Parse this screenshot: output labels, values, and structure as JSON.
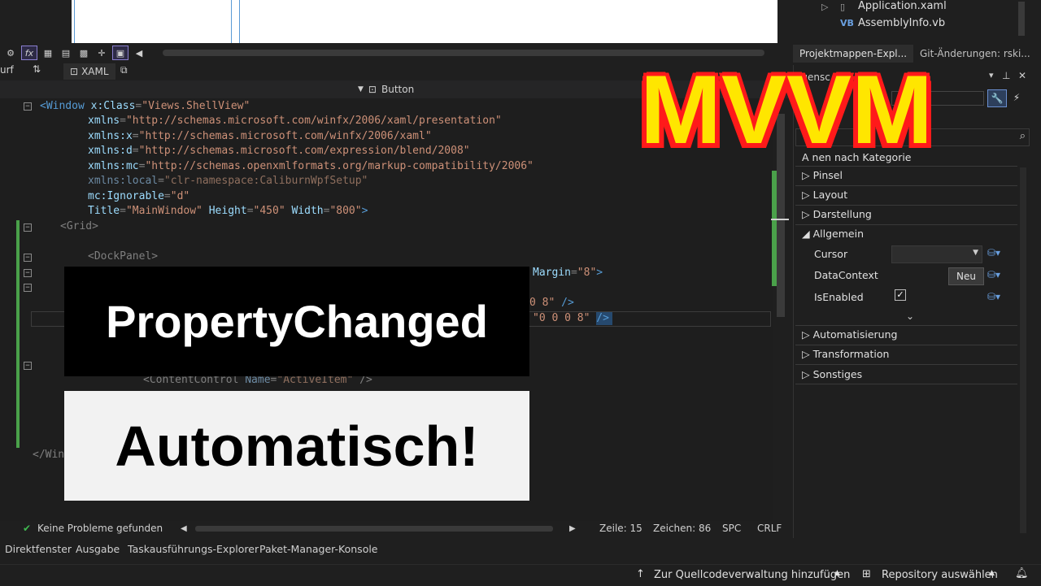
{
  "overlay": {
    "mvvm": "MVVM",
    "property_changed": "PropertyChanged",
    "automatisch": "Automatisch!"
  },
  "solution_explorer": {
    "items": [
      {
        "label": "Application.xaml"
      },
      {
        "label": "AssemblyInfo.vb",
        "badge": "VB"
      }
    ],
    "tab_solution": "Projektmappen-Expl...",
    "tab_git": "Git-Änderungen: rski..."
  },
  "editor": {
    "tab_left_partial": "urf",
    "tab_label": "XAML",
    "nav_element": "Button",
    "lines": {
      "l1_tag": "<Window",
      "l1_attr": "x:Class",
      "l1_val": "\"Views.ShellView\"",
      "l2_attr": "xmlns",
      "l2_val": "\"http://schemas.microsoft.com/winfx/2006/xaml/presentation\"",
      "l3_attr": "xmlns:x",
      "l3_val": "\"http://schemas.microsoft.com/winfx/2006/xaml\"",
      "l4_attr": "xmlns:d",
      "l4_val": "\"http://schemas.microsoft.com/expression/blend/2008\"",
      "l5_attr": "xmlns:mc",
      "l5_val": "\"http://schemas.openxmlformats.org/markup-compatibility/2006\"",
      "l6_attr": "xmlns:local",
      "l6_val": "\"clr-namespace:CaliburnWpfSetup\"",
      "l7_attr": "mc:Ignorable",
      "l7_val": "\"d\"",
      "l8_a1": "Title",
      "l8_v1": "\"MainWindow\"",
      "l8_a2": "Height",
      "l8_v2": "\"450\"",
      "l8_a3": "Width",
      "l8_v3": "\"800\"",
      "l9": "<Grid>",
      "l10": "<DockPanel>",
      "l11_attr": "Margin",
      "l11_val": "\"8\"",
      "l13_val": "0 8\"",
      "l14_val": "\"0 0 0 8\"",
      "l17_tag": "<ContentControl",
      "l17_attr": "Name",
      "l17_val": "\"ActiveItem\"",
      "l17_end": "/>",
      "l21": "</Win"
    }
  },
  "editor_status": {
    "problems": "Keine Probleme gefunden",
    "line": "Zeile: 15",
    "char": "Zeichen: 86",
    "spc": "SPC",
    "crlf": "CRLF"
  },
  "bottom_tabs": [
    "Direktfenster",
    "Ausgabe",
    "Taskausführungs-Explorer",
    "Paket-Manager-Konsole"
  ],
  "vs_status": {
    "source_control": "Zur Quellcodeverwaltung hinzufügen",
    "repository": "Repository auswählen"
  },
  "properties": {
    "header_partial": "igensc",
    "sort_partial": "A    nen nach Kategorie",
    "categories": [
      "Pinsel",
      "Layout",
      "Darstellung",
      "Allgemein",
      "Automatisierung",
      "Transformation",
      "Sonstiges"
    ],
    "rows": {
      "cursor": "Cursor",
      "datacontext": "DataContext",
      "new_button": "Neu",
      "isenabled": "IsEnabled"
    },
    "isenabled_checked": true
  },
  "colors": {
    "mvvm_fill": "#ffe600",
    "mvvm_outline": "#ff1a1a",
    "status_ok": "#3fb950",
    "change_bar": "#4aa14a"
  }
}
